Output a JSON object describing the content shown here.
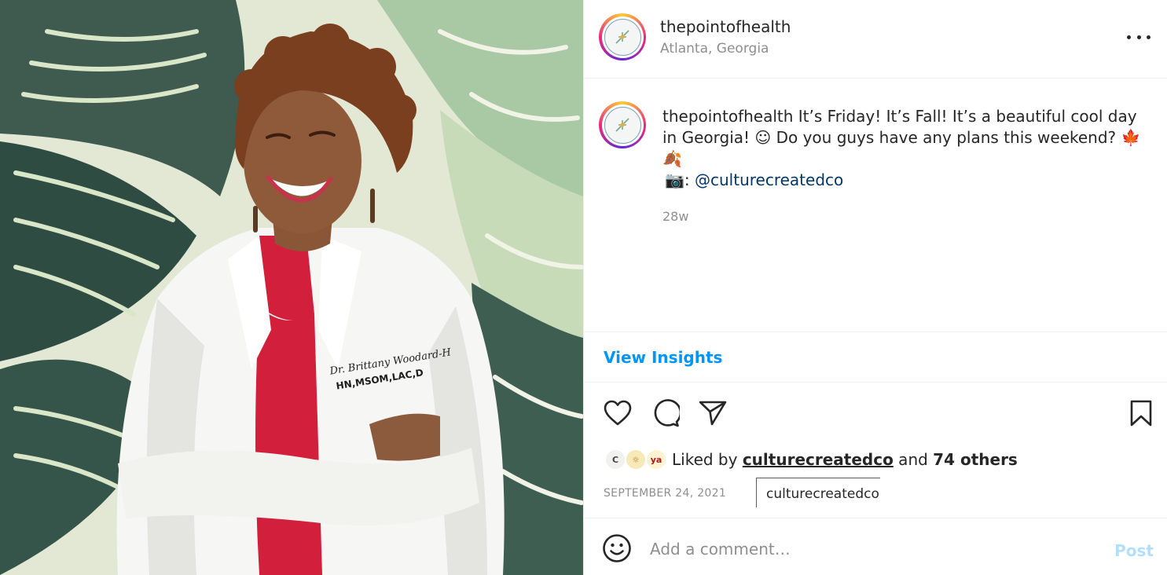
{
  "post": {
    "image_description": "photo-of-smiling-doctor-in-white-coat"
  },
  "coat_embroidery": {
    "line1": "Dr. Brittany Woodard-H",
    "line2": "HN,MSOM,LAC,D"
  },
  "header": {
    "username": "thepointofhealth",
    "location": "Atlanta, Georgia",
    "more_icon": "more-horizontal-icon"
  },
  "caption": {
    "username": "thepointofhealth",
    "text": "It’s Friday! It’s Fall! It’s a beautiful cool day in Georgia! ☺ Do you guys have any plans this weekend? 🍁 🍂",
    "credit_prefix": "📷: ",
    "credit_mention": "@culturecreatedco",
    "time_ago": "28w"
  },
  "insights": {
    "label": "View Insights"
  },
  "actions": {
    "like_icon": "heart-icon",
    "comment_icon": "comment-icon",
    "share_icon": "paper-plane-icon",
    "save_icon": "bookmark-icon"
  },
  "likes": {
    "prefix": "Liked by ",
    "user": "culturecreatedco",
    "middle": " and ",
    "count_text": "74 others",
    "avatar_1": "C",
    "avatar_2": "☼",
    "avatar_3": "ya"
  },
  "date": "SEPTEMBER 24, 2021",
  "tooltip": "culturecreatedco",
  "comment_box": {
    "placeholder": "Add a comment…",
    "post_label": "Post",
    "emoji_icon": "smiley-icon"
  },
  "colors": {
    "link_blue": "#0095f6",
    "mention_blue": "#00376b",
    "post_disabled": "#b2dffc",
    "muted_text": "#8e8e8e"
  }
}
